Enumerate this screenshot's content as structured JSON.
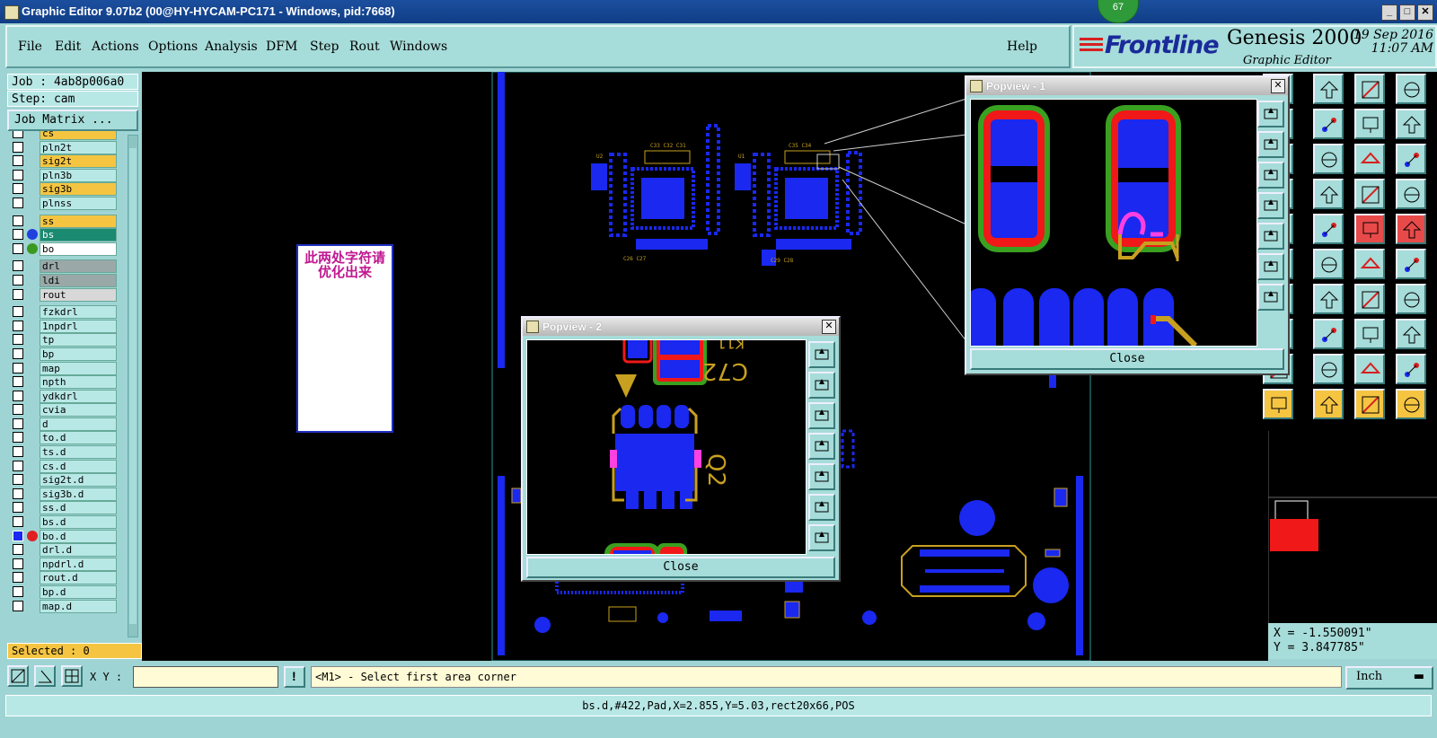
{
  "window": {
    "title": "Graphic Editor 9.07b2 (00@HY-HYCAM-PC171 - Windows, pid:7668)",
    "badge": "67"
  },
  "menu": {
    "items": [
      "File",
      "Edit",
      "Actions",
      "Options",
      "Analysis",
      "DFM",
      "Step",
      "Rout",
      "Windows"
    ],
    "help": "Help"
  },
  "brand": {
    "logo": "Frontline",
    "product": "Genesis 2000",
    "subtitle": "Graphic Editor",
    "date": "19 Sep 2016",
    "time": "11:07 AM"
  },
  "job": {
    "job_label": "Job : 4ab8p006a0",
    "step_label": "Step: cam",
    "matrix_button": "Job Matrix ..."
  },
  "layers": [
    {
      "name": "cs",
      "bg": "#f5c542"
    },
    {
      "name": "pln2t",
      "bg": "#b8e8e6"
    },
    {
      "name": "sig2t",
      "bg": "#f5c542"
    },
    {
      "name": "pln3b",
      "bg": "#b8e8e6"
    },
    {
      "name": "sig3b",
      "bg": "#f5c542"
    },
    {
      "name": "plnss",
      "bg": "#b8e8e6"
    },
    {
      "name": "ss",
      "bg": "#f5c542"
    },
    {
      "name": "bs",
      "bg": "#1a8a70",
      "fg": "#fff",
      "dot": "#2040e0"
    },
    {
      "name": "bo",
      "bg": "#ffffff",
      "dot": "#3a9a20"
    },
    {
      "name": "drl",
      "bg": "#9aa8a8"
    },
    {
      "name": "ldi",
      "bg": "#9aa8a8"
    },
    {
      "name": "rout",
      "bg": "#d8d8d8"
    },
    {
      "name": "fzkdrl",
      "bg": "#b8e8e6"
    },
    {
      "name": "1npdrl",
      "bg": "#b8e8e6"
    },
    {
      "name": "tp",
      "bg": "#b8e8e6"
    },
    {
      "name": "bp",
      "bg": "#b8e8e6"
    },
    {
      "name": "map",
      "bg": "#b8e8e6"
    },
    {
      "name": "npth",
      "bg": "#b8e8e6"
    },
    {
      "name": "ydkdrl",
      "bg": "#b8e8e6"
    },
    {
      "name": "cvia",
      "bg": "#b8e8e6"
    },
    {
      "name": "d",
      "bg": "#b8e8e6"
    },
    {
      "name": "to.d",
      "bg": "#b8e8e6"
    },
    {
      "name": "ts.d",
      "bg": "#b8e8e6"
    },
    {
      "name": "cs.d",
      "bg": "#b8e8e6"
    },
    {
      "name": "sig2t.d",
      "bg": "#b8e8e6"
    },
    {
      "name": "sig3b.d",
      "bg": "#b8e8e6"
    },
    {
      "name": "ss.d",
      "bg": "#b8e8e6"
    },
    {
      "name": "bs.d",
      "bg": "#b8e8e6"
    },
    {
      "name": "bo.d",
      "bg": "#b8e8e6",
      "dot": "#e02020",
      "active": true
    },
    {
      "name": "drl.d",
      "bg": "#b8e8e6"
    },
    {
      "name": "npdrl.d",
      "bg": "#b8e8e6"
    },
    {
      "name": "rout.d",
      "bg": "#b8e8e6"
    },
    {
      "name": "bp.d",
      "bg": "#b8e8e6"
    },
    {
      "name": "map.d",
      "bg": "#b8e8e6"
    }
  ],
  "selected": "Selected : 0",
  "note": {
    "text": "此两处字符请优化出来"
  },
  "popview1": {
    "title": "Popview - 1",
    "close": "Close"
  },
  "popview2": {
    "title": "Popview - 2",
    "close": "Close",
    "labels": [
      "C72",
      "Q2",
      "K11"
    ]
  },
  "coords": {
    "x": "X = -1.550091\"",
    "y": "Y = 3.847785\""
  },
  "command": {
    "xy_label": "X Y :",
    "xy_value": "",
    "prompt": "<M1> - Select first area corner",
    "units": "Inch"
  },
  "status": "bs.d,#422,Pad,X=2.855,Y=5.03,rect20x66,POS",
  "colors": {
    "pad": "#1a28f0",
    "silk": "#c8a020",
    "mask_red": "#f01818",
    "mask_green": "#3aa020"
  }
}
